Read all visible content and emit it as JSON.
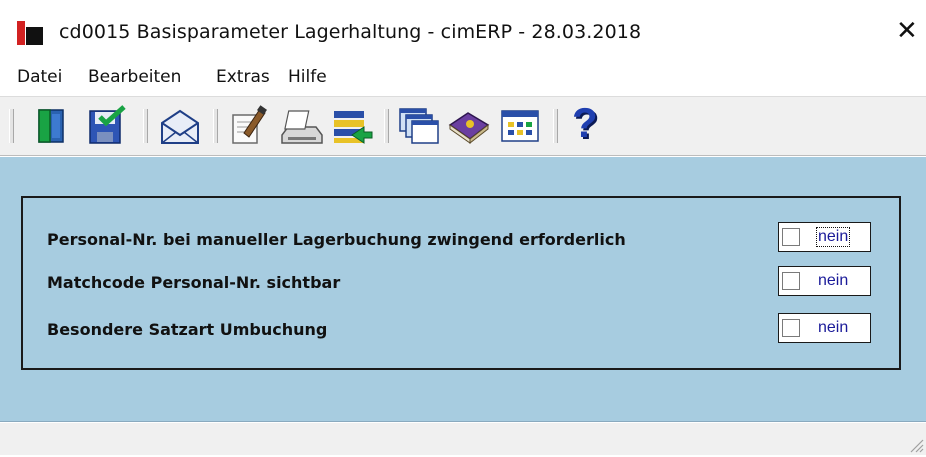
{
  "window": {
    "title": "cd0015 Basisparameter Lagerhaltung - cimERP - 28.03.2018",
    "close_glyph": "✕"
  },
  "menu": {
    "items": [
      "Datei",
      "Bearbeiten",
      "Extras",
      "Hilfe"
    ]
  },
  "toolbar": {
    "buttons": [
      {
        "icon": "exit-door-icon"
      },
      {
        "icon": "save-icon"
      },
      {
        "icon": "mail-icon"
      },
      {
        "icon": "edit-document-icon"
      },
      {
        "icon": "print-icon"
      },
      {
        "icon": "list-transfer-icon"
      },
      {
        "icon": "windows-cascade-icon"
      },
      {
        "icon": "book-icon"
      },
      {
        "icon": "table-window-icon"
      },
      {
        "icon": "help-icon",
        "glyph": "?"
      }
    ]
  },
  "params": [
    {
      "label": "Personal-Nr. bei manueller Lagerbuchung zwingend erforderlich",
      "checked": false,
      "value": "nein"
    },
    {
      "label": "Matchcode Personal-Nr. sichtbar",
      "checked": false,
      "value": "nein"
    },
    {
      "label": "Besondere Satzart Umbuchung",
      "checked": false,
      "value": "nein"
    }
  ],
  "colors": {
    "content_bg": "#a7cce0",
    "value_text": "#1a1a99",
    "app_icon_red": "#d22222"
  }
}
